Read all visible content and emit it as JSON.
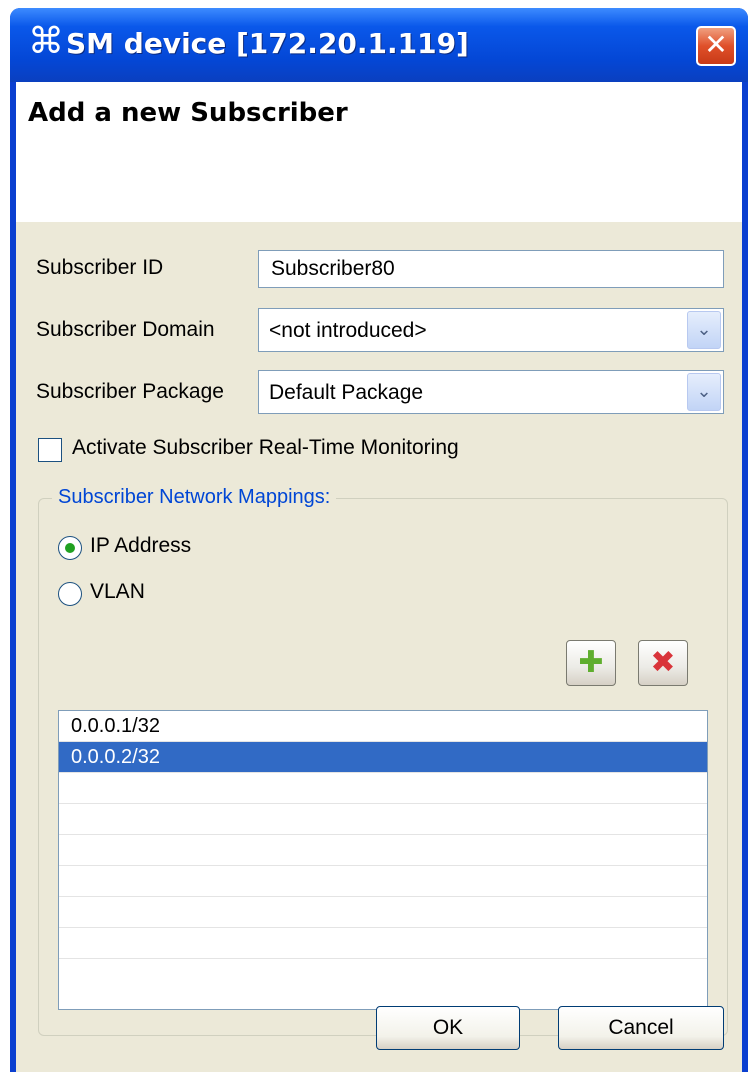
{
  "window": {
    "icon": "command-key-icon",
    "icon_glyph": "⌘",
    "title": "SM device [172.20.1.119]",
    "close_glyph": "✕"
  },
  "header": {
    "title": "Add a new Subscriber"
  },
  "form": {
    "subscriber_id": {
      "label": "Subscriber ID",
      "value": "Subscriber80"
    },
    "subscriber_domain": {
      "label": "Subscriber Domain",
      "value": "<not introduced>"
    },
    "subscriber_package": {
      "label": "Subscriber Package",
      "value": "Default Package"
    },
    "dropdown_glyph": "⌄"
  },
  "monitoring": {
    "label": "Activate Subscriber Real-Time Monitoring",
    "checked": false
  },
  "mappings": {
    "title": "Subscriber Network Mappings:",
    "options": [
      {
        "label": "IP Address",
        "selected": true
      },
      {
        "label": "VLAN",
        "selected": false
      }
    ],
    "add_icon": "plus-icon",
    "add_glyph": "✚",
    "add_color": "#5fae2e",
    "remove_icon": "delete-icon",
    "remove_glyph": "✖",
    "remove_color": "#d9343a",
    "list_items": [
      "0.0.0.1/32",
      "0.0.0.2/32",
      "",
      "",
      "",
      "",
      "",
      ""
    ],
    "selected_item": "0.0.0.2/32"
  },
  "buttons": {
    "ok": "OK",
    "cancel": "Cancel"
  },
  "colors": {
    "titlebar": "#0a58ea",
    "selection": "#316ac5",
    "groupbox_title": "#0046d5"
  }
}
